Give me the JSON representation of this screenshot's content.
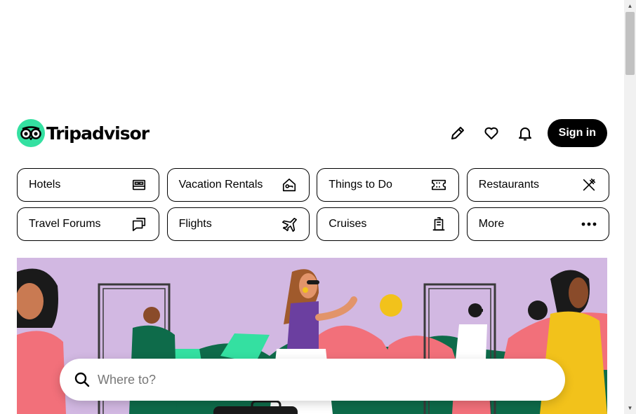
{
  "brand": {
    "name": "Tripadvisor",
    "accent": "#34e0a1"
  },
  "header": {
    "review_icon": "pencil-icon",
    "saves_icon": "heart-icon",
    "notifications_icon": "bell-icon",
    "signin_label": "Sign in"
  },
  "categories": [
    {
      "label": "Hotels",
      "icon": "bed-icon"
    },
    {
      "label": "Vacation Rentals",
      "icon": "house-key-icon"
    },
    {
      "label": "Things to Do",
      "icon": "ticket-icon"
    },
    {
      "label": "Restaurants",
      "icon": "fork-knife-icon"
    },
    {
      "label": "Travel Forums",
      "icon": "chat-bubbles-icon"
    },
    {
      "label": "Flights",
      "icon": "plane-icon"
    },
    {
      "label": "Cruises",
      "icon": "ship-icon"
    },
    {
      "label": "More",
      "icon": "more-dots-icon"
    }
  ],
  "search": {
    "placeholder": "Where to?"
  },
  "hero": {
    "background": "#d2b8e2"
  }
}
